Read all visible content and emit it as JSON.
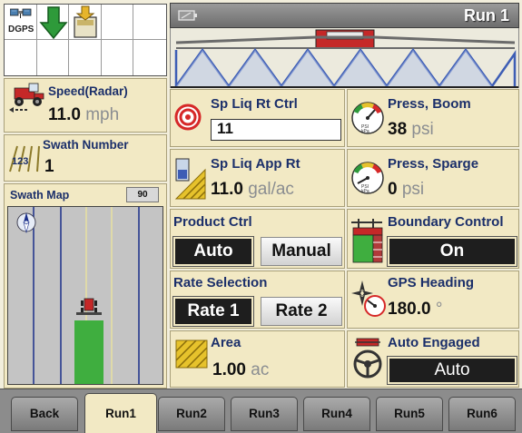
{
  "status_bar": {
    "dgps_label": "DGPS",
    "icons": [
      "dgps-icon",
      "down-arrow-icon",
      "memory-card-icon"
    ]
  },
  "speed": {
    "label": "Speed(Radar)",
    "value": "11.0",
    "unit": "mph"
  },
  "swath_number": {
    "label": "Swath Number",
    "value": "1",
    "icon_text": "123"
  },
  "swath_map": {
    "title": "Swath Map",
    "zoom_button": "90"
  },
  "header": {
    "title": "Run 1"
  },
  "tiles": {
    "sp_liq_rt_ctrl": {
      "label": "Sp Liq Rt Ctrl",
      "value": "11"
    },
    "press_boom": {
      "label": "Press, Boom",
      "value": "38",
      "unit": "psi",
      "gauge_unit": "kPa"
    },
    "sp_liq_app_rt": {
      "label": "Sp Liq App Rt",
      "value": "11.0",
      "unit": "gal/ac"
    },
    "press_sparge": {
      "label": "Press, Sparge",
      "value": "0",
      "unit": "psi",
      "gauge_unit": "kPa"
    },
    "product_ctrl": {
      "label": "Product Ctrl",
      "auto_button": "Auto",
      "manual_button": "Manual"
    },
    "boundary_control": {
      "label": "Boundary Control",
      "value": "On"
    },
    "rate_selection": {
      "label": "Rate Selection",
      "rate1_button": "Rate 1",
      "rate2_button": "Rate 2"
    },
    "gps_heading": {
      "label": "GPS Heading",
      "value": "180.0",
      "unit": "°"
    },
    "area": {
      "label": "Area",
      "value": "1.00",
      "unit": "ac"
    },
    "auto_engaged": {
      "label": "Auto Engaged",
      "value": "Auto"
    }
  },
  "tabs": [
    "Back",
    "Run1",
    "Run2",
    "Run3",
    "Run4",
    "Run5",
    "Run6"
  ],
  "active_tab": "Run1",
  "colors": {
    "label_blue": "#1b2f6a",
    "panel_bg": "#f2e9c4",
    "boom_blue": "#3d5db5",
    "green": "#3fae3f",
    "target_red": "#d62828"
  }
}
